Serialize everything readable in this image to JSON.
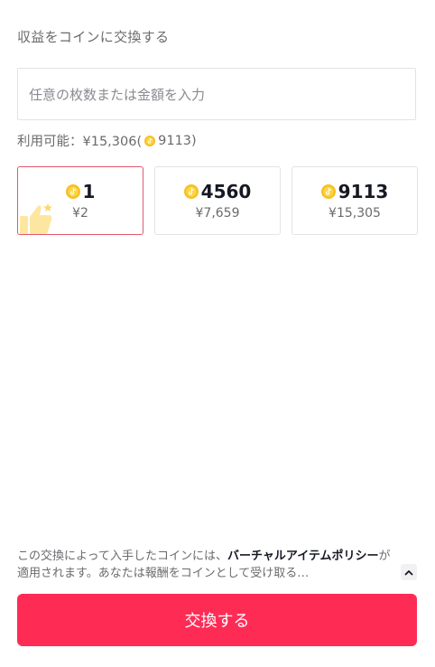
{
  "section_title": "収益をコインに交換する",
  "amount_input": {
    "placeholder": "任意の枚数または金額を入力"
  },
  "available": {
    "prefix": "利用可能：¥15,306(",
    "coins": "9113",
    "suffix": ")"
  },
  "options": [
    {
      "coins": "1",
      "price": "¥2",
      "selected": true
    },
    {
      "coins": "4560",
      "price": "¥7,659",
      "selected": false
    },
    {
      "coins": "9113",
      "price": "¥15,305",
      "selected": false
    }
  ],
  "policy": {
    "text_before": "この交換によって入手したコインには、",
    "link": "バーチャルアイテムポリシー",
    "text_after": "が適用されます。あなたは報酬をコインとして受け取る…"
  },
  "exchange_button": {
    "label": "交換する"
  },
  "colors": {
    "accent": "#fe2c55",
    "selected_border": "#e5576c",
    "coin": "#f6c021"
  },
  "icons": {
    "coin": "tiktok-coin-icon",
    "thumb": "thumbs-up-icon",
    "expand": "chevron-up-icon"
  }
}
